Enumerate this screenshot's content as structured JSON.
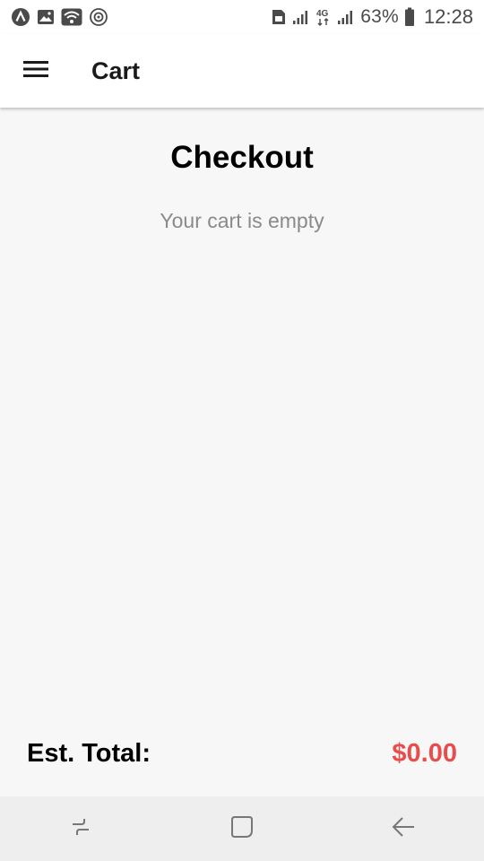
{
  "status_bar": {
    "battery": "63%",
    "time": "12:28",
    "network": "4G",
    "left_icons": [
      "app-logo-icon",
      "image-icon",
      "wifi-icon",
      "sync-icon"
    ],
    "right_icons": [
      "sim-icon",
      "signal-icon",
      "4g-icon",
      "signal-icon",
      "battery-icon"
    ]
  },
  "app_bar": {
    "title": "Cart",
    "menu_icon": "hamburger-menu-icon"
  },
  "main": {
    "heading": "Checkout",
    "empty_message": "Your cart is empty"
  },
  "footer": {
    "total_label": "Est. Total:",
    "total_value": "$0.00",
    "total_color": "#e84c4c"
  },
  "nav_bar": {
    "buttons": [
      "recent-apps-icon",
      "home-icon",
      "back-icon"
    ]
  }
}
